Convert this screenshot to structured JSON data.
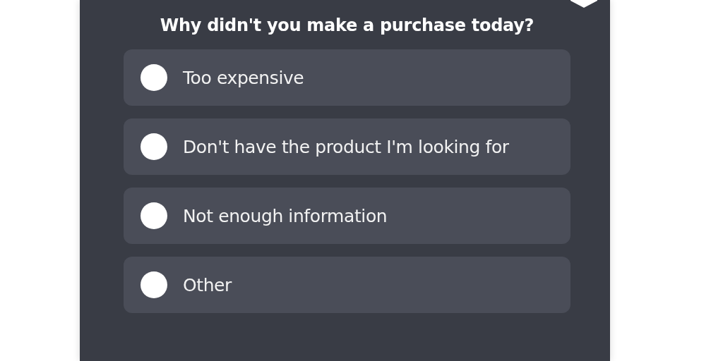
{
  "question": "Why didn't you make a purchase today?",
  "options": [
    {
      "label": "Too expensive",
      "selected": false
    },
    {
      "label": "Don't have the product I'm looking for",
      "selected": false
    },
    {
      "label": "Not enough information",
      "selected": false
    },
    {
      "label": "Other",
      "selected": false
    }
  ]
}
